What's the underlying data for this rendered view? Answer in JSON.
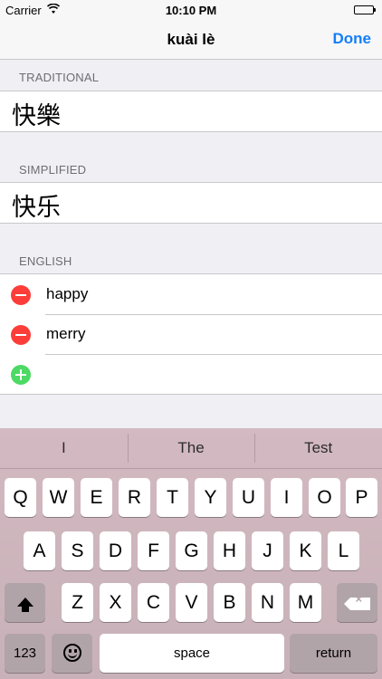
{
  "status_bar": {
    "carrier": "Carrier",
    "time": "10:10 PM"
  },
  "nav": {
    "title": "kuài lè",
    "done_label": "Done"
  },
  "sections": {
    "traditional": {
      "header": "TRADITIONAL",
      "value": "快樂"
    },
    "simplified": {
      "header": "SIMPLIFIED",
      "value": "快乐"
    },
    "english": {
      "header": "ENGLISH",
      "items": [
        "happy",
        "merry"
      ]
    }
  },
  "keyboard": {
    "suggestions": [
      "I",
      "The",
      "Test"
    ],
    "row1": [
      "Q",
      "W",
      "E",
      "R",
      "T",
      "Y",
      "U",
      "I",
      "O",
      "P"
    ],
    "row2": [
      "A",
      "S",
      "D",
      "F",
      "G",
      "H",
      "J",
      "K",
      "L"
    ],
    "row3": [
      "Z",
      "X",
      "C",
      "V",
      "B",
      "N",
      "M"
    ],
    "numbers_label": "123",
    "space_label": "space",
    "return_label": "return"
  },
  "icons": {
    "wifi": "wifi-icon",
    "battery": "battery-icon",
    "delete": "minus-circle-icon",
    "add": "plus-circle-icon",
    "shift": "shift-arrow-icon",
    "backspace": "backspace-icon",
    "emoji": "emoji-icon"
  },
  "colors": {
    "accent": "#147efb",
    "delete": "#fc3d39",
    "add": "#4cd964"
  }
}
